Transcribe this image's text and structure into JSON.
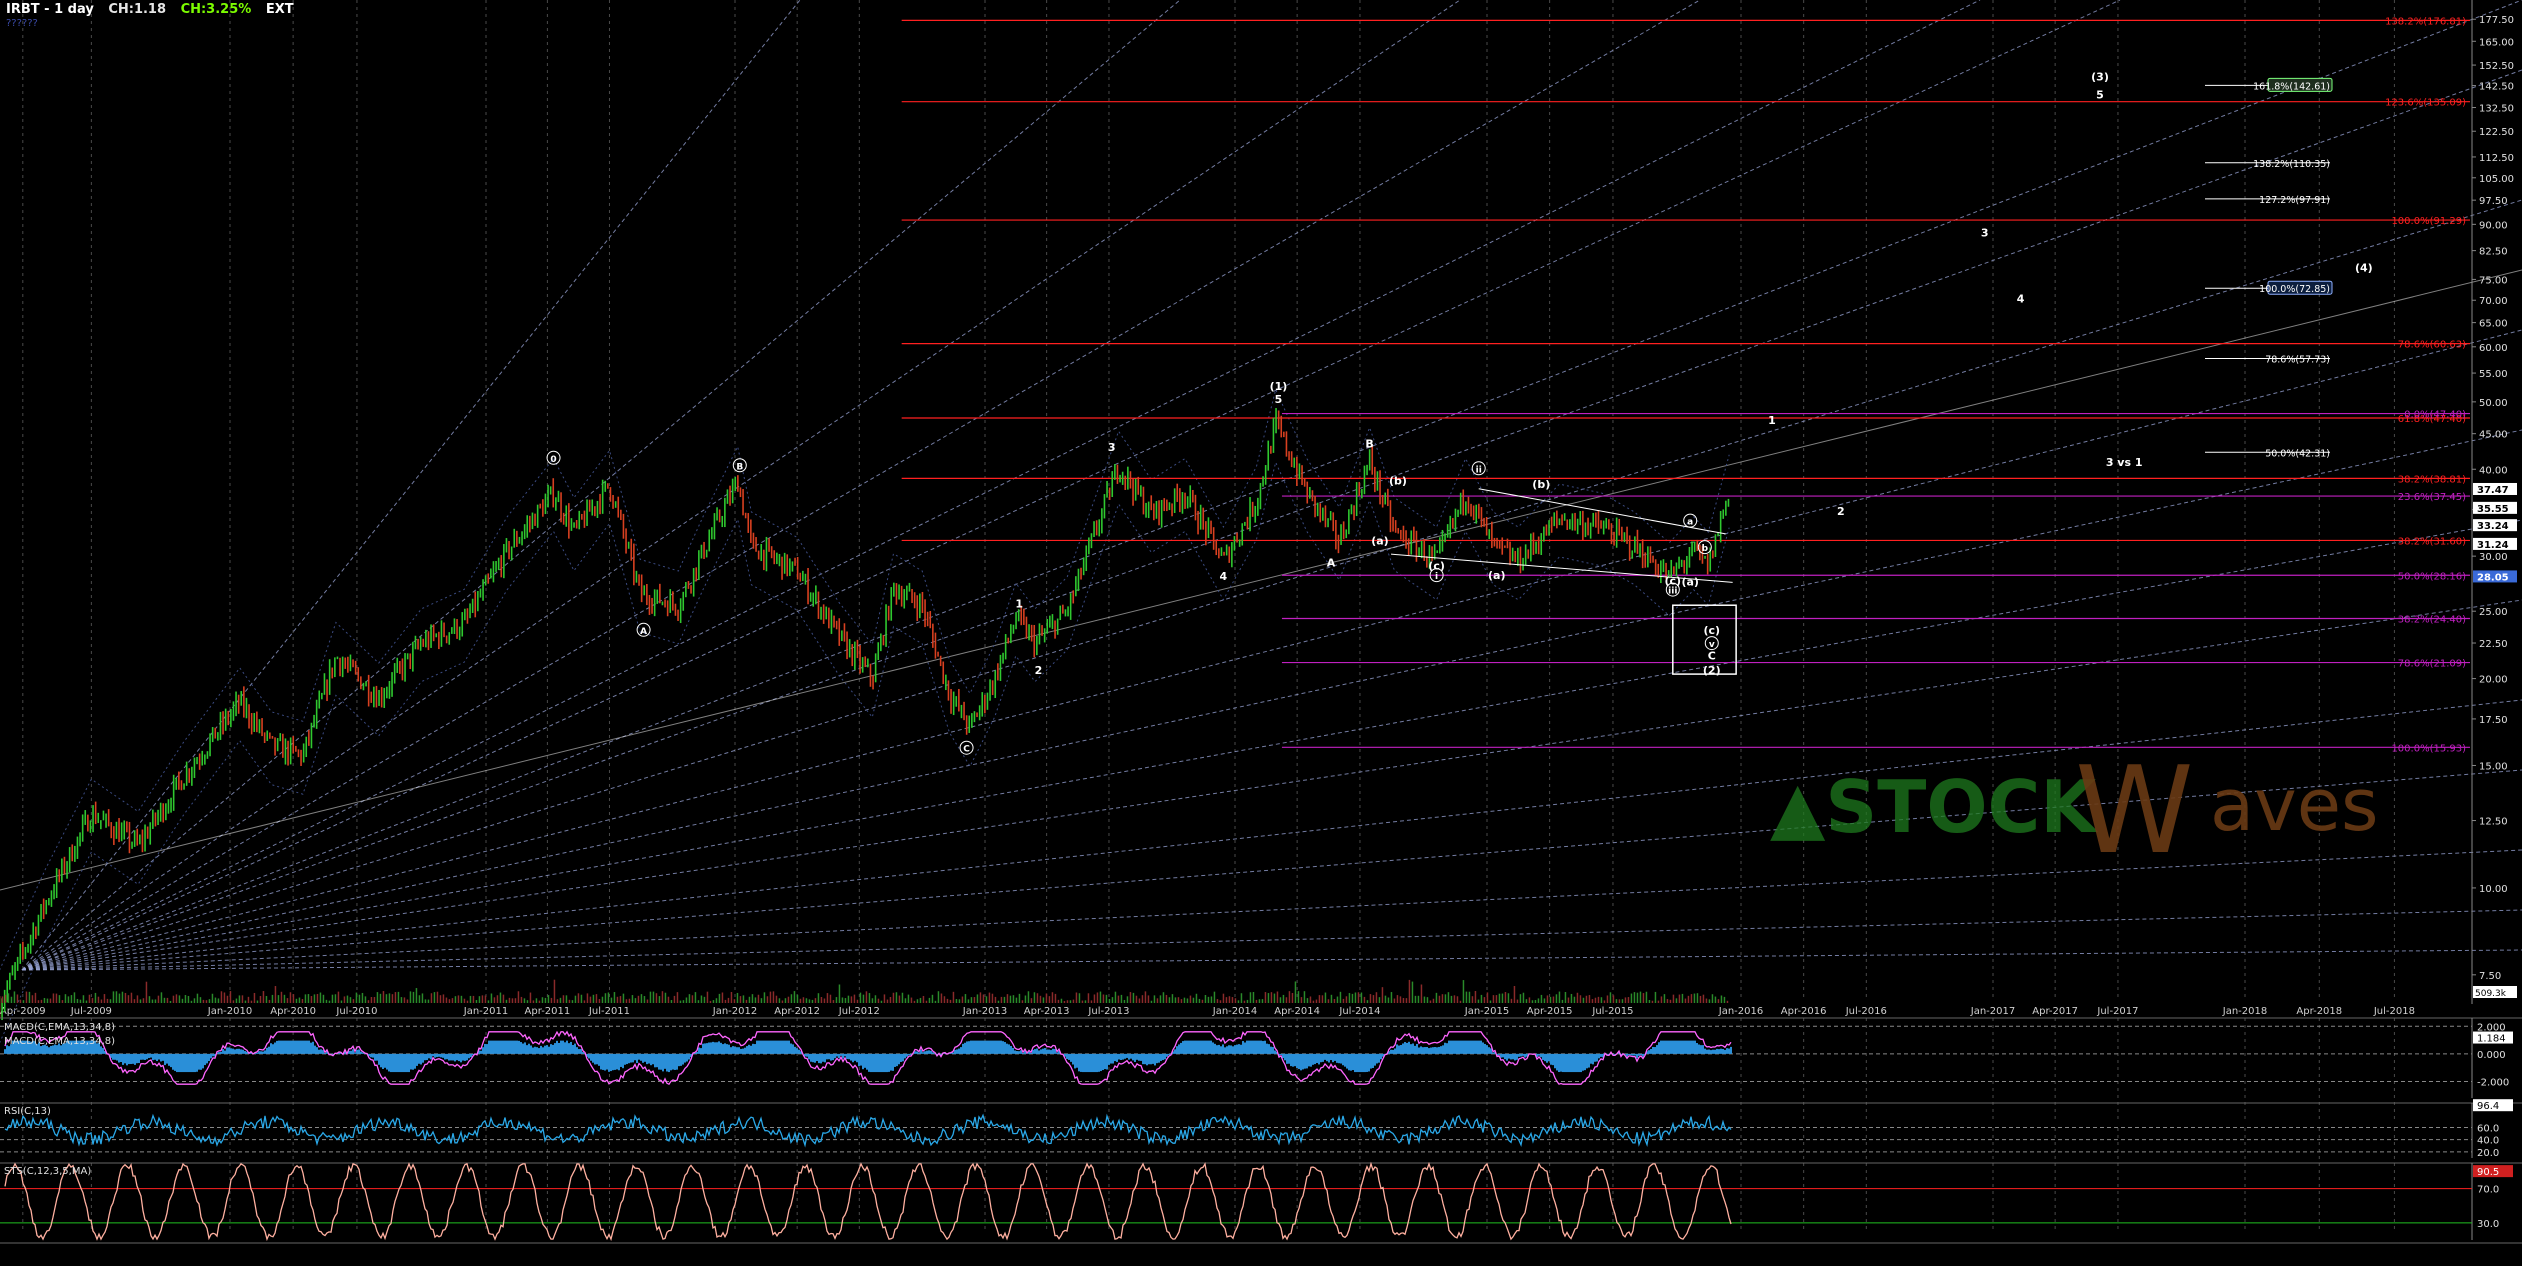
{
  "header": {
    "symbol": "IRBT - 1 day",
    "change": "CH:1.18",
    "change_pct": "CH:3.25%",
    "session": "EXT",
    "sub_label": "??????"
  },
  "colors": {
    "background": "#000000",
    "grid": "#4a4a4a",
    "fib_red": "#ff2020",
    "fib_magenta": "#c020c0",
    "fan_lines": "#9aa6d8",
    "price_up": "#2fc82f",
    "price_down": "#d84020",
    "macd_line": "#ff66ff",
    "macd_hist": "#2a8fd8",
    "rsi_line": "#2aa8e8",
    "stoch_line": "#ffb0a0",
    "watermark_green": "#1e7a1e",
    "watermark_brown": "#6a3a14"
  },
  "watermark": {
    "text_a": "STOCK",
    "text_b": "aves",
    "letter": "W"
  },
  "chart_data": {
    "type": "line",
    "title": "IRBT - 1 day",
    "y_scale": "log",
    "price_axis_ticks": [
      "177.50",
      "165.00",
      "152.50",
      "142.50",
      "132.50",
      "122.50",
      "112.50",
      "105.00",
      "97.50",
      "90.00",
      "82.50",
      "75.00",
      "70.00",
      "65.00",
      "60.00",
      "55.00",
      "50.00",
      "45.00",
      "40.00",
      "35.00",
      "30.00",
      "25.00",
      "22.50",
      "20.00",
      "17.50",
      "15.00",
      "12.50",
      "10.00",
      "7.50"
    ],
    "date_axis_ticks": [
      "Apr-2009",
      "Jul-2009",
      "Jan-2010",
      "Apr-2010",
      "Jul-2010",
      "Jan-2011",
      "Apr-2011",
      "Jul-2011",
      "Jan-2012",
      "Apr-2012",
      "Jul-2012",
      "Jan-2013",
      "Apr-2013",
      "Jul-2013",
      "Jan-2014",
      "Apr-2014",
      "Jul-2014",
      "Jan-2015",
      "Apr-2015",
      "Jul-2015",
      "Jan-2016",
      "Apr-2016",
      "Jul-2016",
      "Jan-2017",
      "Apr-2017",
      "Jul-2017",
      "Jan-2018",
      "Apr-2018",
      "Jul-2018"
    ],
    "price_path": [
      [
        "2009-03-01",
        6.8
      ],
      [
        "2009-05-01",
        9.5
      ],
      [
        "2009-07-01",
        12.8
      ],
      [
        "2009-09-01",
        11.5
      ],
      [
        "2009-11-01",
        14.5
      ],
      [
        "2010-01-15",
        18.5
      ],
      [
        "2010-03-01",
        16.0
      ],
      [
        "2010-04-15",
        15.5
      ],
      [
        "2010-06-01",
        21.5
      ],
      [
        "2010-08-01",
        18.8
      ],
      [
        "2010-10-01",
        22.5
      ],
      [
        "2010-12-01",
        24.0
      ],
      [
        "2011-02-01",
        30.5
      ],
      [
        "2011-04-10",
        37.0
      ],
      [
        "2011-05-10",
        32.5
      ],
      [
        "2011-07-01",
        38.0
      ],
      [
        "2011-08-15",
        26.5
      ],
      [
        "2011-10-10",
        25.5
      ],
      [
        "2011-11-15",
        30.5
      ],
      [
        "2012-01-05",
        38.5
      ],
      [
        "2012-01-25",
        31.0
      ],
      [
        "2012-04-01",
        28.5
      ],
      [
        "2012-06-01",
        23.0
      ],
      [
        "2012-07-20",
        20.0
      ],
      [
        "2012-08-20",
        27.0
      ],
      [
        "2012-10-01",
        25.5
      ],
      [
        "2012-11-10",
        19.0
      ],
      [
        "2012-12-10",
        17.0
      ],
      [
        "2013-01-15",
        20.0
      ],
      [
        "2013-02-15",
        24.5
      ],
      [
        "2013-03-15",
        22.5
      ],
      [
        "2013-05-01",
        25.0
      ],
      [
        "2013-07-15",
        40.5
      ],
      [
        "2013-09-01",
        34.5
      ],
      [
        "2013-10-20",
        37.0
      ],
      [
        "2013-12-15",
        29.5
      ],
      [
        "2014-02-01",
        36.0
      ],
      [
        "2014-03-01",
        46.5
      ],
      [
        "2014-04-15",
        37.0
      ],
      [
        "2014-06-01",
        31.5
      ],
      [
        "2014-07-15",
        41.0
      ],
      [
        "2014-08-20",
        32.5
      ],
      [
        "2014-10-20",
        29.5
      ],
      [
        "2014-12-01",
        37.0
      ],
      [
        "2015-01-10",
        31.0
      ],
      [
        "2015-02-15",
        29.5
      ],
      [
        "2015-04-15",
        34.0
      ],
      [
        "2015-06-15",
        33.0
      ],
      [
        "2015-08-01",
        31.0
      ],
      [
        "2015-09-20",
        28.0
      ],
      [
        "2015-10-25",
        30.5
      ],
      [
        "2015-11-15",
        29.0
      ],
      [
        "2015-12-15",
        37.47
      ]
    ],
    "fib_levels": [
      {
        "label": "138.2%(176.81)",
        "value": 176.81,
        "color": "red",
        "from": "2012-09-01"
      },
      {
        "label": "123.6%(135.09)",
        "value": 135.09,
        "color": "red",
        "from": "2012-09-01"
      },
      {
        "label": "100.0%(91.29)",
        "value": 91.29,
        "color": "red",
        "from": "2012-09-01"
      },
      {
        "label": "78.6%(60.63)",
        "value": 60.63,
        "color": "red",
        "from": "2012-09-01"
      },
      {
        "label": "61.8%(47.40)",
        "value": 47.4,
        "color": "red",
        "from": "2012-09-01"
      },
      {
        "label": "0.0%(47.40)",
        "value": 48.1,
        "color": "magenta",
        "from": "2014-03-10"
      },
      {
        "label": "38.2%(38.81)",
        "value": 38.81,
        "color": "red",
        "from": "2012-09-01"
      },
      {
        "label": "23.6%(37.45)",
        "value": 36.6,
        "color": "magenta",
        "from": "2014-03-10"
      },
      {
        "label": "38.2%(31.60)",
        "value": 31.6,
        "color": "red",
        "from": "2012-09-01"
      },
      {
        "label": "50.0%(28.16)",
        "value": 28.16,
        "color": "magenta",
        "from": "2014-03-10"
      },
      {
        "label": "38.2%(24.40)",
        "value": 24.4,
        "color": "magenta",
        "from": "2014-03-10"
      },
      {
        "label": "78.6%(21.09)",
        "value": 21.09,
        "color": "magenta",
        "from": "2014-03-10"
      },
      {
        "label": "100.0%(15.93)",
        "value": 15.93,
        "color": "magenta",
        "from": "2014-03-10"
      }
    ],
    "projection_levels": [
      {
        "label": "161.8%(142.61)",
        "value": 142.61,
        "boxed": true
      },
      {
        "label": "138.2%(110.35)",
        "value": 110.35,
        "boxed": false
      },
      {
        "label": "127.2%(97.91)",
        "value": 97.91,
        "boxed": false
      },
      {
        "label": "100.0%(72.85)",
        "value": 72.85,
        "boxed": true
      },
      {
        "label": "78.6%(57.73)",
        "value": 57.73,
        "boxed": false
      },
      {
        "label": "50.0%(42.31)",
        "value": 42.31,
        "boxed": false
      }
    ],
    "price_tags": [
      {
        "label": "37.47",
        "value": 37.47,
        "bg": "#ffffff",
        "fg": "#000000"
      },
      {
        "label": "35.55",
        "value": 35.2,
        "bg": "#ffffff",
        "fg": "#000000"
      },
      {
        "label": "33.24",
        "value": 33.24,
        "bg": "#ffffff",
        "fg": "#000000"
      },
      {
        "label": "31.24",
        "value": 31.24,
        "bg": "#ffffff",
        "fg": "#000000"
      },
      {
        "label": "28.05",
        "value": 28.05,
        "bg": "#3a6ad8",
        "fg": "#ffffff"
      }
    ],
    "wave_labels": [
      {
        "text": "0",
        "date": "2011-04-10",
        "price": 41.0,
        "circled": true
      },
      {
        "text": "A",
        "date": "2011-08-20",
        "price": 23.2,
        "circled": true
      },
      {
        "text": "B",
        "date": "2012-01-08",
        "price": 40.0,
        "circled": true
      },
      {
        "text": "C",
        "date": "2012-12-05",
        "price": 15.7,
        "circled": true
      },
      {
        "text": "1",
        "date": "2013-02-20",
        "price": 25.3,
        "circled": false
      },
      {
        "text": "2",
        "date": "2013-03-20",
        "price": 20.3,
        "circled": false
      },
      {
        "text": "3",
        "date": "2013-07-05",
        "price": 42.5,
        "circled": false
      },
      {
        "text": "4",
        "date": "2013-12-15",
        "price": 27.7,
        "circled": false
      },
      {
        "text": "(1)",
        "date": "2014-03-05",
        "price": 52.0,
        "circled": false
      },
      {
        "text": "5",
        "date": "2014-03-05",
        "price": 49.8,
        "circled": false
      },
      {
        "text": "A",
        "date": "2014-05-20",
        "price": 29.0,
        "circled": false
      },
      {
        "text": "B",
        "date": "2014-07-15",
        "price": 43.0,
        "circled": false
      },
      {
        "text": "(a)",
        "date": "2014-07-30",
        "price": 31.2,
        "circled": false
      },
      {
        "text": "(b)",
        "date": "2014-08-25",
        "price": 38.0,
        "circled": false
      },
      {
        "text": "(c)",
        "date": "2014-10-20",
        "price": 28.7,
        "circled": false
      },
      {
        "text": "i",
        "date": "2014-10-20",
        "price": 27.8,
        "circled": true
      },
      {
        "text": "ii",
        "date": "2014-12-20",
        "price": 39.6,
        "circled": true
      },
      {
        "text": "(a)",
        "date": "2015-01-15",
        "price": 27.8,
        "circled": false
      },
      {
        "text": "(b)",
        "date": "2015-03-20",
        "price": 37.6,
        "circled": false
      },
      {
        "text": "(c)",
        "date": "2015-09-25",
        "price": 27.3,
        "circled": false
      },
      {
        "text": "iii",
        "date": "2015-09-25",
        "price": 26.5,
        "circled": true
      },
      {
        "text": "(a)",
        "date": "2015-10-20",
        "price": 27.2,
        "circled": false
      },
      {
        "text": "a",
        "date": "2015-10-20",
        "price": 33.3,
        "circled": true
      },
      {
        "text": "b",
        "date": "2015-11-10",
        "price": 30.5,
        "circled": true
      },
      {
        "text": "(c)",
        "date": "2015-11-20",
        "price": 23.2,
        "circled": false
      },
      {
        "text": "v",
        "date": "2015-11-20",
        "price": 22.2,
        "circled": true
      },
      {
        "text": "C",
        "date": "2015-11-20",
        "price": 21.3,
        "circled": false
      },
      {
        "text": "(2)",
        "date": "2015-11-20",
        "price": 20.3,
        "circled": false
      },
      {
        "text": "1",
        "date": "2016-02-15",
        "price": 46.5,
        "circled": false
      },
      {
        "text": "2",
        "date": "2016-05-25",
        "price": 34.4,
        "circled": false
      },
      {
        "text": "3",
        "date": "2016-12-20",
        "price": 86.5,
        "circled": false
      },
      {
        "text": "4",
        "date": "2017-02-10",
        "price": 69.5,
        "circled": false
      },
      {
        "text": "(3)",
        "date": "2017-06-05",
        "price": 145.0,
        "circled": false
      },
      {
        "text": "5",
        "date": "2017-06-05",
        "price": 136.5,
        "circled": false
      },
      {
        "text": "(4)",
        "date": "2018-05-25",
        "price": 77.0,
        "circled": false
      },
      {
        "text": "3 vs 1",
        "date": "2017-07-10",
        "price": 40.4,
        "circled": false
      }
    ],
    "target_box": {
      "from": "2015-09-25",
      "to": "2015-12-25",
      "low": 20.3,
      "high": 25.5
    },
    "indicators": {
      "macd": {
        "label_1": "MACD(C,EMA,13,34,8)",
        "label_2": "MACD(C,EMA,13,34,8)",
        "ticks": [
          "2.000",
          "1.184",
          "0.000",
          "-2.000"
        ],
        "range": [
          -3.2,
          2.6
        ],
        "last": 1.184
      },
      "rsi": {
        "label": "RSI(C,13)",
        "ticks": [
          "96.4",
          "60.0",
          "40.0",
          "20.0"
        ],
        "range": [
          10,
          100
        ],
        "last": 96.4
      },
      "stoch": {
        "label": "STS(C,12,3,5,MA)",
        "ticks": [
          "90.5",
          "70.0",
          "30.0"
        ],
        "range": [
          10,
          100
        ],
        "last": 90.5
      }
    }
  }
}
